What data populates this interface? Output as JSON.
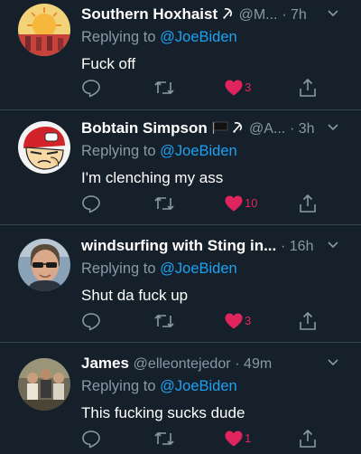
{
  "tweets": [
    {
      "name": "Southern Hoxhaist",
      "handle": "@M...",
      "time": "· 7h",
      "reply_prefix": "Replying to ",
      "reply_handle": "@JoeBiden",
      "text": "Fuck off",
      "likes": "3",
      "avatar": "sunrise-poster-avatar",
      "name_icons": [
        "hammer-sickle-icon"
      ]
    },
    {
      "name": "Bobtain Simpson",
      "handle": "@A...",
      "time": "· 3h",
      "reply_prefix": "Replying to ",
      "reply_handle": "@JoeBiden",
      "text": "I'm clenching my ass",
      "likes": "10",
      "avatar": "cartoon-pilot-avatar",
      "name_icons": [
        "black-flag-icon",
        "hammer-sickle-icon"
      ]
    },
    {
      "name": "windsurfing with Sting in...",
      "handle": "",
      "time": "· 16h",
      "reply_prefix": "Replying to ",
      "reply_handle": "@JoeBiden",
      "text": "Shut da fuck up",
      "likes": "3",
      "avatar": "man-sunglasses-avatar",
      "name_icons": []
    },
    {
      "name": "James",
      "handle": "@elleontejedor",
      "time": "· 49m",
      "reply_prefix": "Replying to ",
      "reply_handle": "@JoeBiden",
      "text": "This fucking sucks dude",
      "likes": "1",
      "avatar": "group-photo-avatar",
      "name_icons": []
    }
  ],
  "colors": {
    "background": "#15202b",
    "divider": "#38444d",
    "muted": "#8899a6",
    "link": "#1da1f2",
    "like": "#e0245e"
  }
}
